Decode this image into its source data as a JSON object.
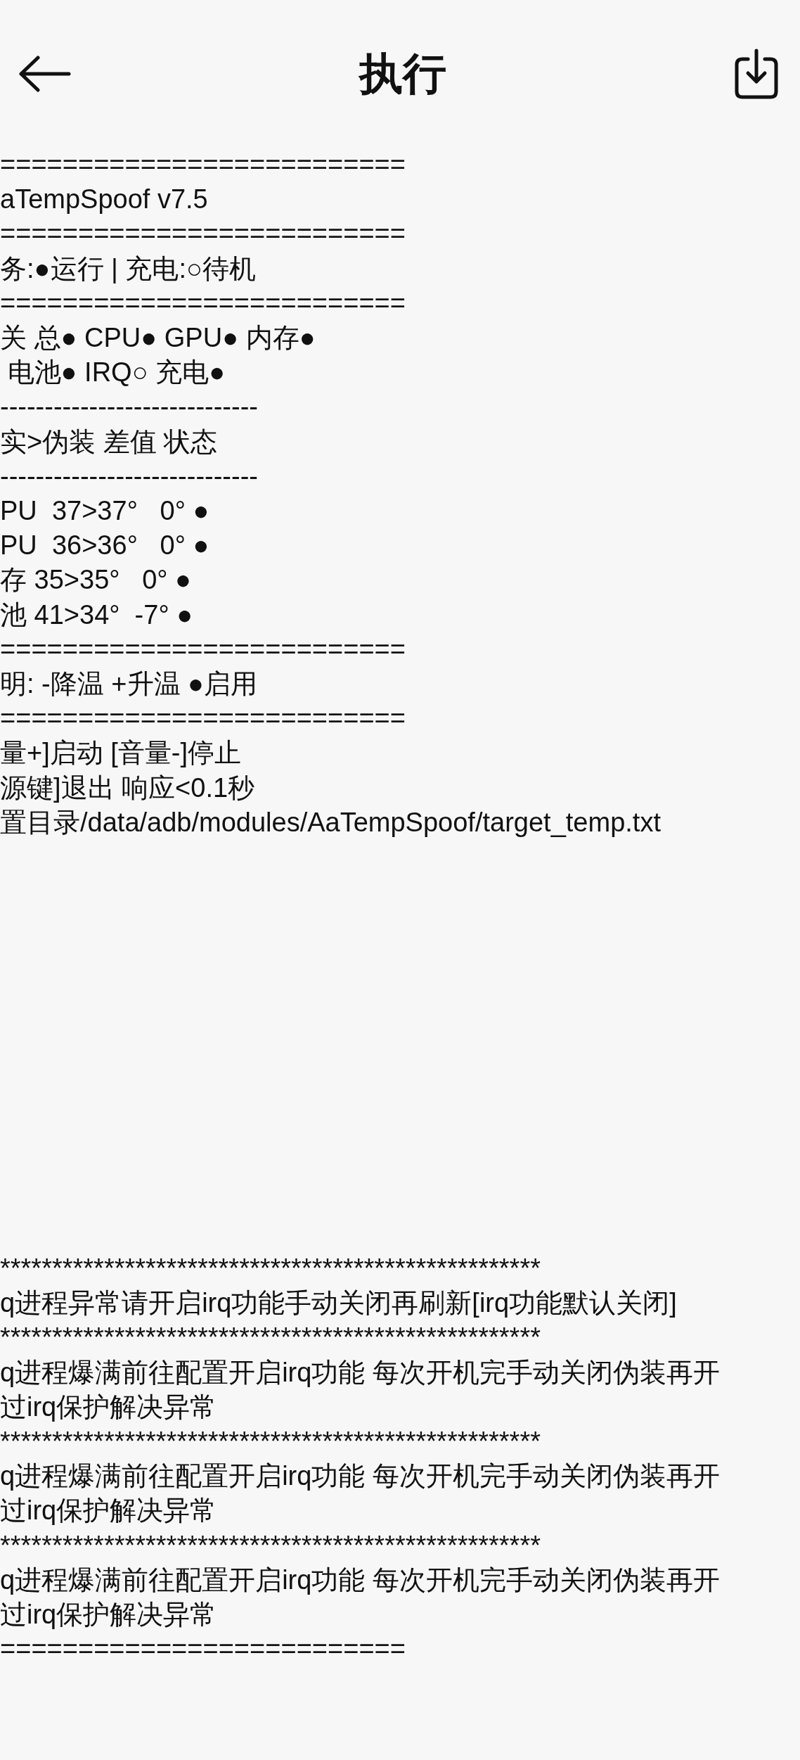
{
  "app_bar": {
    "title": "执行"
  },
  "output_top": {
    "lines": [
      "==========================",
      "aTempSpoof v7.5",
      "==========================",
      "务:●运行 | 充电:○待机",
      "==========================",
      "关 总● CPU● GPU● 内存●",
      " 电池● IRQ○ 充电●",
      "-----------------------------",
      "实>伪装 差值 状态",
      "-----------------------------",
      "PU  37>37°   0° ●",
      "PU  36>36°   0° ●",
      "存 35>35°   0° ●",
      "池 41>34°  -7° ●",
      "==========================",
      "明: -降温 +升温 ●启用",
      "==========================",
      "量+]启动 [音量-]停止",
      "源键]退出 响应<0.1秒",
      "置目录/data/adb/modules/AaTempSpoof/target_temp.txt"
    ]
  },
  "output_bottom": {
    "lines": [
      "****************************************************",
      "q进程异常请开启irq功能手动关闭再刷新[irq功能默认关闭]",
      "****************************************************",
      "q进程爆满前往配置开启irq功能 每次开机完手动关闭伪装再开",
      "过irq保护解决异常",
      "****************************************************",
      "q进程爆满前往配置开启irq功能 每次开机完手动关闭伪装再开",
      "过irq保护解决异常",
      "****************************************************",
      "q进程爆满前往配置开启irq功能 每次开机完手动关闭伪装再开",
      "过irq保护解决异常",
      "=========================="
    ]
  }
}
